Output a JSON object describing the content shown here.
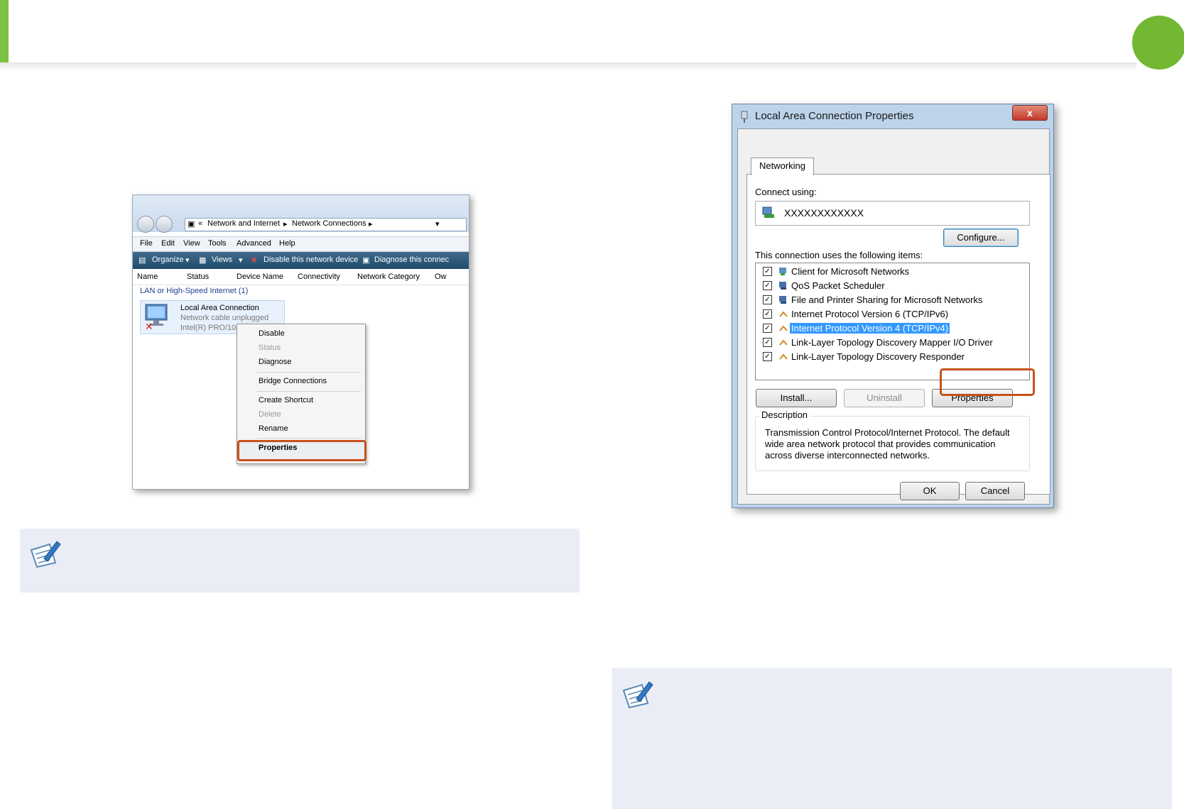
{
  "explorer": {
    "address_sep": "«",
    "address_crumb1": "Network and Internet",
    "address_crumb2": "Network Connections",
    "menu": [
      "File",
      "Edit",
      "View",
      "Tools",
      "Advanced",
      "Help"
    ],
    "toolbar": {
      "organize": "Organize",
      "views": "Views",
      "disable": "Disable this network device",
      "diagnose": "Diagnose this connec"
    },
    "columns": [
      "Name",
      "Status",
      "Device Name",
      "Connectivity",
      "Network Category",
      "Ow"
    ],
    "group_label": "LAN or High-Speed Internet (1)",
    "item": {
      "name": "Local Area Connection",
      "status": "Network cable unplugged",
      "device": "Intel(R) PRO/100"
    },
    "context_menu": {
      "disable": "Disable",
      "status": "Status",
      "diagnose": "Diagnose",
      "bridge": "Bridge Connections",
      "shortcut": "Create Shortcut",
      "delete": "Delete",
      "rename": "Rename",
      "properties": "Properties"
    }
  },
  "dialog": {
    "title": "Local Area Connection Properties",
    "close": "x",
    "tab": "Networking",
    "connect_using_label": "Connect using:",
    "adapter": "XXXXXXXXXXXX",
    "configure": "Configure...",
    "items_label": "This connection uses the following items:",
    "items": [
      {
        "label": "Client for Microsoft Networks",
        "checked": true,
        "icon": "network-client-icon"
      },
      {
        "label": "QoS Packet Scheduler",
        "checked": true,
        "icon": "network-service-icon"
      },
      {
        "label": "File and Printer Sharing for Microsoft Networks",
        "checked": true,
        "icon": "network-service-icon"
      },
      {
        "label": "Internet Protocol Version 6 (TCP/IPv6)",
        "checked": true,
        "icon": "protocol-icon"
      },
      {
        "label": "Internet Protocol Version 4 (TCP/IPv4)",
        "checked": true,
        "icon": "protocol-icon",
        "selected": true
      },
      {
        "label": "Link-Layer Topology Discovery Mapper I/O Driver",
        "checked": true,
        "icon": "protocol-icon"
      },
      {
        "label": "Link-Layer Topology Discovery Responder",
        "checked": true,
        "icon": "protocol-icon"
      }
    ],
    "install": "Install...",
    "uninstall": "Uninstall",
    "properties": "Properties",
    "description_label": "Description",
    "description": "Transmission Control Protocol/Internet Protocol. The default wide area network protocol that provides communication across diverse interconnected networks.",
    "ok": "OK",
    "cancel": "Cancel"
  },
  "colors": {
    "accent_green": "#73b833",
    "highlight_orange": "#c8511b",
    "note_bg": "#eaedf5"
  }
}
